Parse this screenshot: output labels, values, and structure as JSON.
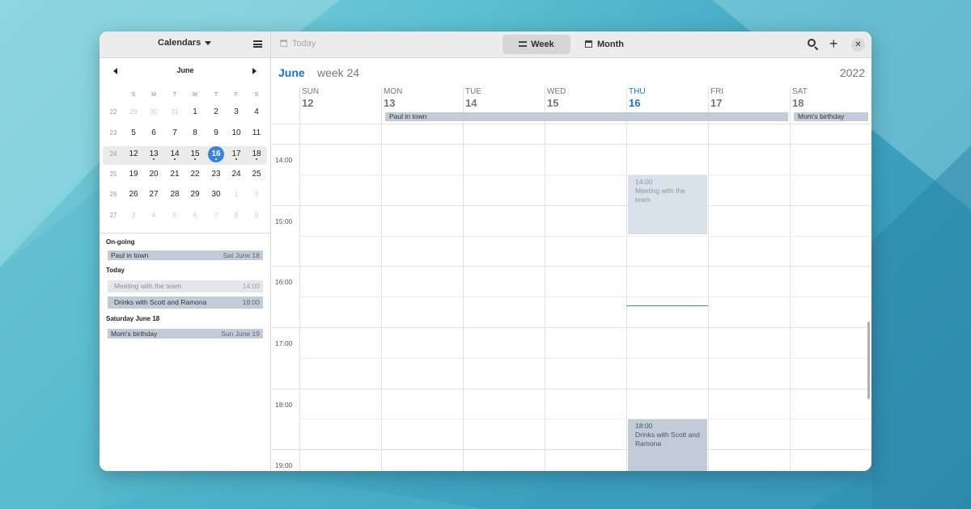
{
  "header": {
    "calendars_label": "Calendars",
    "today_label": "Today",
    "week_label": "Week",
    "month_label": "Month"
  },
  "mini_calendar": {
    "month": "June",
    "weekdays": [
      "S",
      "M",
      "T",
      "W",
      "T",
      "F",
      "S"
    ],
    "rows": [
      {
        "week": "22",
        "days": [
          "29",
          "30",
          "31",
          "1",
          "2",
          "3",
          "4"
        ]
      },
      {
        "week": "23",
        "days": [
          "5",
          "6",
          "7",
          "8",
          "9",
          "10",
          "11"
        ]
      },
      {
        "week": "24",
        "days": [
          "12",
          "13",
          "14",
          "15",
          "16",
          "17",
          "18"
        ]
      },
      {
        "week": "25",
        "days": [
          "19",
          "20",
          "21",
          "22",
          "23",
          "24",
          "25"
        ]
      },
      {
        "week": "26",
        "days": [
          "26",
          "27",
          "28",
          "29",
          "30",
          "1",
          "2"
        ]
      },
      {
        "week": "27",
        "days": [
          "3",
          "4",
          "5",
          "6",
          "7",
          "8",
          "9"
        ]
      }
    ]
  },
  "agenda": {
    "ongoing_header": "On-going",
    "ongoing": [
      {
        "title": "Paul in town",
        "time": "Sat June 18"
      }
    ],
    "today_header": "Today",
    "today": [
      {
        "title": "Meeting with the team",
        "time": "14:00"
      },
      {
        "title": "Drinks with Scott and Ramona",
        "time": "18:00"
      }
    ],
    "saturday_header": "Saturday June 18",
    "saturday": [
      {
        "title": "Mom's birthday",
        "time": "Sun June 19"
      }
    ]
  },
  "week_view": {
    "month": "June",
    "week": "week 24",
    "year": "2022",
    "days": [
      {
        "name": "SUN",
        "num": "12"
      },
      {
        "name": "MON",
        "num": "13"
      },
      {
        "name": "TUE",
        "num": "14"
      },
      {
        "name": "WED",
        "num": "15"
      },
      {
        "name": "THU",
        "num": "16"
      },
      {
        "name": "FRI",
        "num": "17"
      },
      {
        "name": "SAT",
        "num": "18"
      }
    ],
    "allday_events": [
      "Paul in town",
      "Mom's birthday"
    ],
    "hours": [
      "14:00",
      "15:00",
      "16:00",
      "17:00",
      "18:00",
      "19:00"
    ],
    "events": [
      {
        "time": "14:00",
        "title": "Meeting with the team"
      },
      {
        "time": "18:00",
        "title": "Drinks with Scott and Ramona"
      }
    ]
  },
  "colors": {
    "accent": "#1c71d8",
    "today_circle": "#3584e4",
    "event_fill": "#c2ccd9"
  }
}
